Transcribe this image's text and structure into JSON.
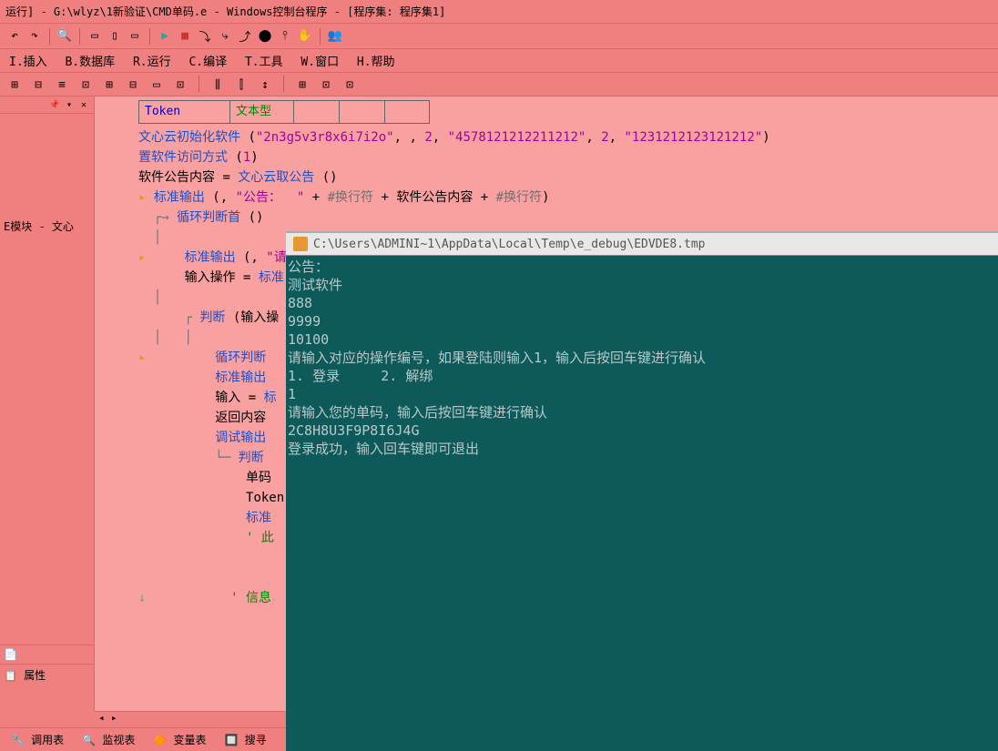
{
  "title": "运行] - G:\\wlyz\\1新验证\\CMD单码.e - Windows控制台程序 - [程序集: 程序集1]",
  "menu": {
    "insert": "I.插入",
    "database": "B.数据库",
    "run": "R.运行",
    "compile": "C.编译",
    "tools": "T.工具",
    "window": "W.窗口",
    "help": "H.帮助"
  },
  "leftPanel": {
    "moduleLabel": "E模块 - 文心",
    "propTab": "📋 属性"
  },
  "tableHeader": {
    "col1": "Token",
    "col2": "文本型"
  },
  "code": {
    "l1a": "文心云初始化软件",
    "l1b": "(",
    "l1c": "\"2n3g5v3r8x6i7i2o\"",
    "l1d": ", , ",
    "l1e": "2",
    "l1f": ", ",
    "l1g": "\"4578121212211212\"",
    "l1h": ", ",
    "l1i": "2",
    "l1j": ", ",
    "l1k": "\"1231212123121212\"",
    "l1l": ")",
    "l2a": "置软件访问方式",
    "l2b": " (",
    "l2c": "1",
    "l2d": ")",
    "l3a": "软件公告内容 ",
    "l3b": "= ",
    "l3c": "文心云取公告",
    "l3d": " ()",
    "l4a": "标准输出",
    "l4b": " (, ",
    "l4c": "\"公告：  \"",
    "l4d": " + ",
    "l4e": "#换行符",
    "l4f": " + ",
    "l4g": "软件公告内容",
    "l4h": " + ",
    "l4i": "#换行符",
    "l4j": ")",
    "l5a": "循环判断首",
    "l5b": " ()",
    "l6a": "标准输出",
    "l6b": " (, ",
    "l6c": "\"请",
    "l7a": "输入操作 ",
    "l7b": "= ",
    "l7c": "标准",
    "l8a": "判断",
    "l8b": " (输入操",
    "l9a": "循环判断",
    "l10a": "标准输出",
    "l11a": "输入 ",
    "l11b": "= ",
    "l11c": "标",
    "l12a": "返回内容",
    "l13a": "调试输出",
    "l14a": "判断",
    "l15a": "单码",
    "l16a": "Token",
    "l17a": "标准",
    "l18a": "' 此",
    "l19a": "' 信息"
  },
  "console": {
    "title": "C:\\Users\\ADMINI~1\\AppData\\Local\\Temp\\e_debug\\EDVDE8.tmp",
    "line1": "公告：",
    "line2": "测试软件",
    "line3": "888",
    "line4": "9999",
    "line5": "10100",
    "line6": "请输入对应的操作编号，如果登陆则输入1，输入后按回车键进行确认",
    "line7": "1. 登录     2. 解绑",
    "line8": "1",
    "line9": "请输入您的单码，输入后按回车键进行确认",
    "line10": "2C8H8U3F9P8I6J4G",
    "line11": "登录成功，输入回车键即可退出"
  },
  "bottomTabs": {
    "t1": "🔧 调用表",
    "t2": "🔍 监视表",
    "t3": "🔶 变量表",
    "t4": "🔲 搜寻"
  }
}
